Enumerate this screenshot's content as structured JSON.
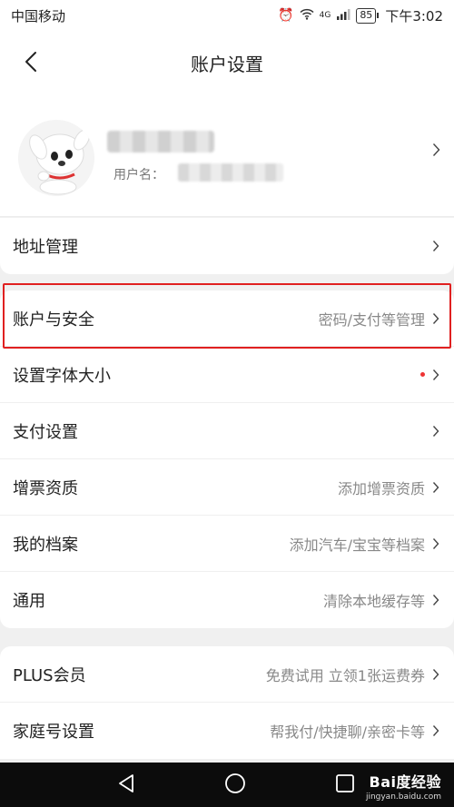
{
  "status_bar": {
    "carrier": "中国移动",
    "network": "4G",
    "battery": "85",
    "time": "下午3:02"
  },
  "nav": {
    "title": "账户设置"
  },
  "profile": {
    "username_label": "用户名："
  },
  "groups": [
    {
      "items": [
        {
          "label": "地址管理",
          "sub": ""
        }
      ]
    },
    {
      "items": [
        {
          "label": "账户与安全",
          "sub": "密码/支付等管理"
        },
        {
          "label": "设置字体大小",
          "sub": ""
        },
        {
          "label": "支付设置",
          "sub": ""
        },
        {
          "label": "增票资质",
          "sub": "添加增票资质"
        },
        {
          "label": "我的档案",
          "sub": "添加汽车/宝宝等档案"
        },
        {
          "label": "通用",
          "sub": "清除本地缓存等"
        }
      ]
    },
    {
      "items": [
        {
          "label": "PLUS会员",
          "sub": "免费试用 立领1张运费券"
        },
        {
          "label": "家庭号设置",
          "sub": "帮我付/快捷聊/亲密卡等"
        }
      ]
    }
  ],
  "watermark": {
    "brand": "Bai度经验",
    "url": "jingyan.baidu.com"
  },
  "colors": {
    "highlight": "#e02020",
    "badge_dot": "#e33333",
    "bottom_bar": "#0c0c0c"
  }
}
